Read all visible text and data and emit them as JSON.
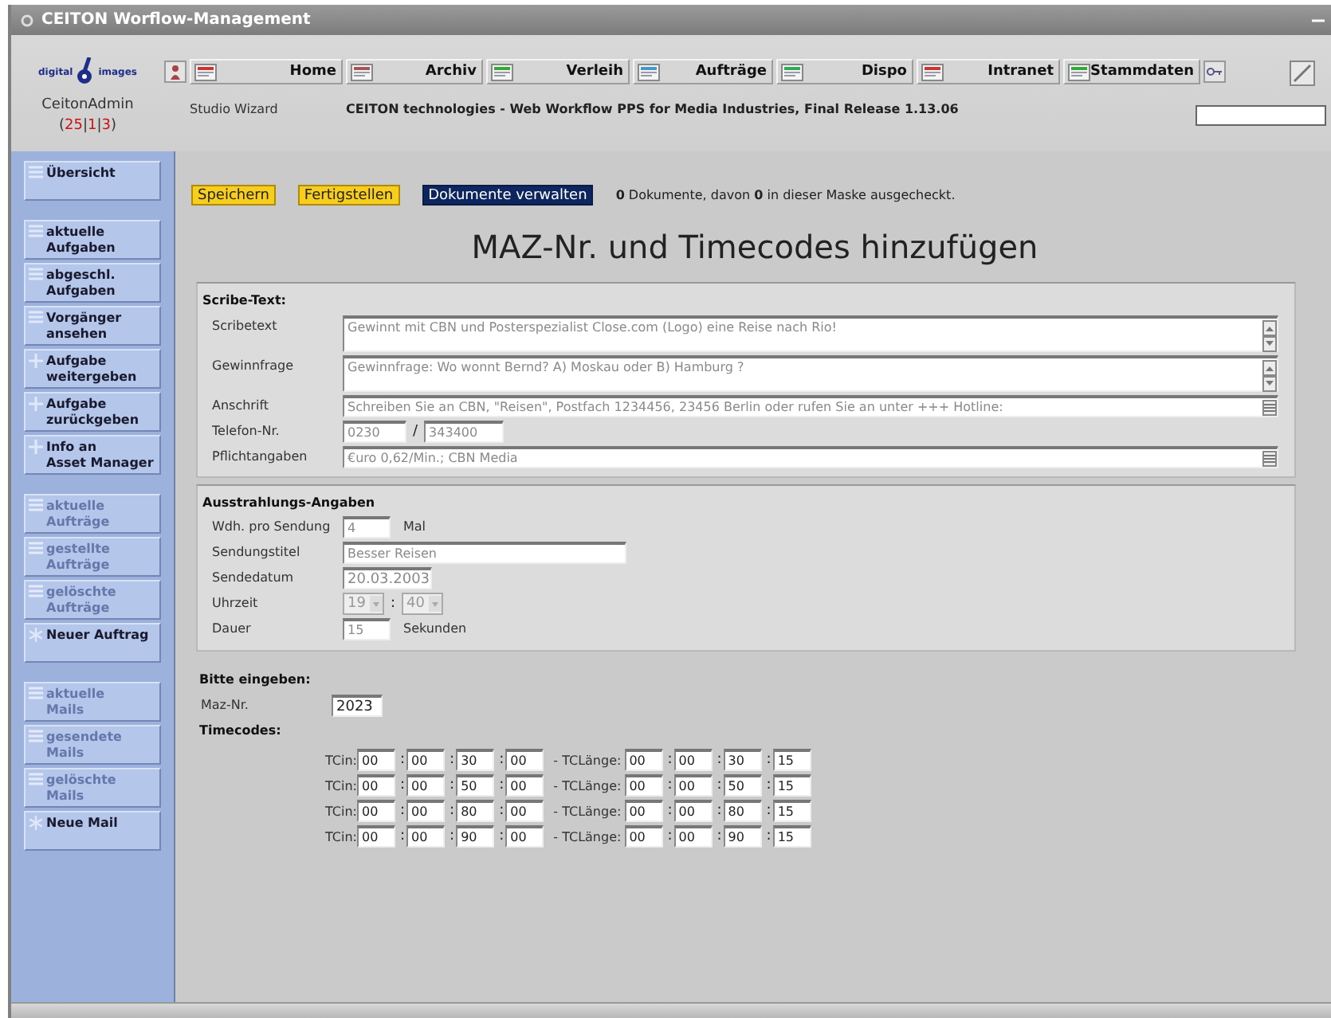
{
  "window": {
    "title": "CEITON Worflow-Management"
  },
  "header": {
    "logo": {
      "left": "digital",
      "right": "images"
    },
    "user": {
      "name": "CeitonAdmin",
      "prefix": "(",
      "separator": "|",
      "suffix": ")",
      "counts": [
        "25",
        "1",
        "3"
      ]
    },
    "nav": [
      {
        "label": "Home"
      },
      {
        "label": "Archiv"
      },
      {
        "label": "Verleih"
      },
      {
        "label": "Aufträge"
      },
      {
        "label": "Dispo"
      },
      {
        "label": "Intranet"
      },
      {
        "label": "Stammdaten"
      }
    ],
    "module": "Studio Wizard",
    "version": "CEITON technologies - Web Workflow PPS for Media Industries, Final Release 1.13.06"
  },
  "sidebar": [
    {
      "items": [
        {
          "label": "Übersicht",
          "kind": "list",
          "disabled": false
        }
      ]
    },
    {
      "items": [
        {
          "label": "aktuelle\nAufgaben",
          "kind": "list",
          "disabled": false
        },
        {
          "label": "abgeschl.\nAufgaben",
          "kind": "list",
          "disabled": false
        },
        {
          "label": "Vorgänger\nansehen",
          "kind": "list",
          "disabled": false
        },
        {
          "label": "Aufgabe\nweitergeben",
          "kind": "action",
          "disabled": false
        },
        {
          "label": "Aufgabe\nzurückgeben",
          "kind": "action",
          "disabled": false
        },
        {
          "label": "Info an\nAsset Manager",
          "kind": "action",
          "disabled": false
        }
      ]
    },
    {
      "items": [
        {
          "label": "aktuelle\nAufträge",
          "kind": "list",
          "disabled": true
        },
        {
          "label": "gestellte\nAufträge",
          "kind": "list",
          "disabled": true
        },
        {
          "label": "gelöschte\nAufträge",
          "kind": "list",
          "disabled": true
        },
        {
          "label": "Neuer Auftrag",
          "kind": "new",
          "disabled": false
        }
      ]
    },
    {
      "items": [
        {
          "label": "aktuelle\nMails",
          "kind": "list",
          "disabled": true
        },
        {
          "label": "gesendete\nMails",
          "kind": "list",
          "disabled": true
        },
        {
          "label": "gelöschte\nMails",
          "kind": "list",
          "disabled": true
        },
        {
          "label": "Neue Mail",
          "kind": "new",
          "disabled": false
        }
      ]
    }
  ],
  "toolbar": {
    "buttons": [
      {
        "label": "Speichern",
        "kind": "yellow"
      },
      {
        "label": "Fertigstellen",
        "kind": "yellow"
      },
      {
        "label": "Dokumente verwalten",
        "kind": "dark"
      }
    ],
    "status": "**0** Dokumente, davon **0** in dieser Maske ausgecheckt."
  },
  "page_title": "MAZ-Nr. und Timecodes hinzufügen",
  "scribe": {
    "title": "Scribe-Text:",
    "fields": [
      {
        "label": "Scribetext",
        "kind": "area",
        "value": "Gewinnt mit CBN und Posterspezialist Close.com (Logo) eine Reise nach Rio!",
        "disabled": true
      },
      {
        "label": "Gewinnfrage",
        "kind": "area",
        "value": "Gewinnfrage: Wo wonnt Bernd? A) Moskau oder B) Hamburg ?",
        "disabled": true
      },
      {
        "label": "Anschrift",
        "kind": "line",
        "value": "Schreiben Sie an CBN, \"Reisen\", Postfach 1234456, 23456 Berlin oder rufen Sie an unter +++ Hotline:",
        "disabled": true
      },
      {
        "label": "Telefon-Nr.",
        "kind": "phone",
        "values": [
          "0230",
          "343400"
        ],
        "separator": "/",
        "disabled": true
      },
      {
        "label": "Pflichtangaben",
        "kind": "line",
        "value": "€uro 0,62/Min.; CBN Media",
        "disabled": true
      }
    ]
  },
  "broadcast": {
    "title": "Ausstrahlungs-Angaben",
    "fields": [
      {
        "label": "Wdh. pro Sendung",
        "kind": "short",
        "value": "4",
        "unit": "Mal"
      },
      {
        "label": "Sendungstitel",
        "kind": "wide",
        "value": "Besser Reisen"
      },
      {
        "label": "Sendedatum",
        "kind": "date",
        "value": "20.03.2003"
      },
      {
        "label": "Uhrzeit",
        "kind": "time",
        "values": [
          "19",
          "40"
        ],
        "separator": ":"
      },
      {
        "label": "Dauer",
        "kind": "short",
        "value": "15",
        "unit": "Sekunden"
      }
    ]
  },
  "entry": {
    "title": "Bitte eingeben:",
    "maz_label": "Maz-Nr.",
    "maz_value": "2023"
  },
  "timecodes": {
    "title": "Timecodes:",
    "separator": ":",
    "rows": [
      {
        "in_label": "TCin:",
        "tc_in": [
          "00",
          "00",
          "30",
          "00"
        ],
        "len_label": "- TCLänge:",
        "tc_len": [
          "00",
          "00",
          "30",
          "15"
        ]
      },
      {
        "in_label": "TCin:",
        "tc_in": [
          "00",
          "00",
          "50",
          "00"
        ],
        "len_label": "- TCLänge:",
        "tc_len": [
          "00",
          "00",
          "50",
          "15"
        ]
      },
      {
        "in_label": "TCin:",
        "tc_in": [
          "00",
          "00",
          "80",
          "00"
        ],
        "len_label": "- TCLänge:",
        "tc_len": [
          "00",
          "00",
          "80",
          "15"
        ]
      },
      {
        "in_label": "TCin:",
        "tc_in": [
          "00",
          "00",
          "90",
          "00"
        ],
        "len_label": "- TCLänge:",
        "tc_len": [
          "00",
          "00",
          "90",
          "15"
        ]
      }
    ]
  }
}
